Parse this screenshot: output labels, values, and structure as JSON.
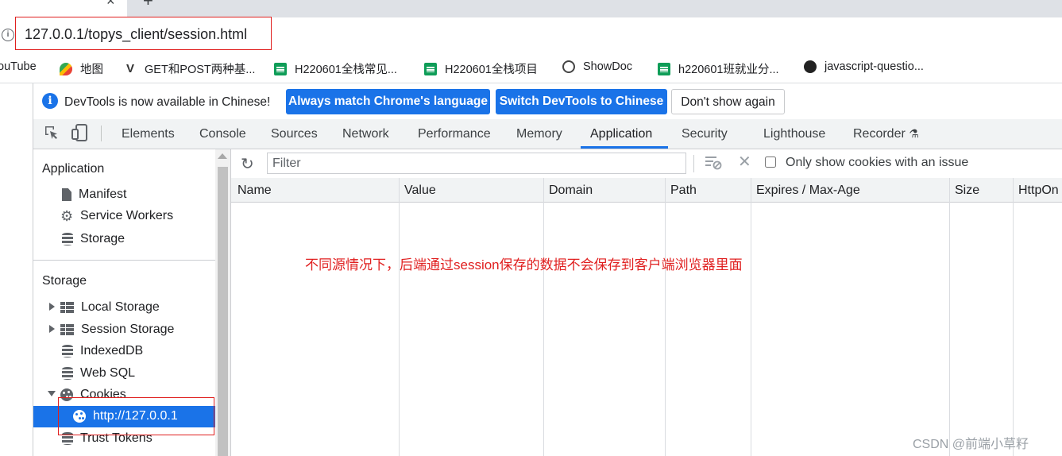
{
  "browser": {
    "url": "127.0.0.1/topys_client/session.html",
    "bookmarks": [
      {
        "label": "ouTube",
        "icon": "youtube-icon"
      },
      {
        "label": "地图",
        "icon": "maps-icon"
      },
      {
        "label": "GET和POST两种基...",
        "icon": "v-logo-icon"
      },
      {
        "label": "H220601全栈常见...",
        "icon": "sheets-icon"
      },
      {
        "label": "H220601全栈项目",
        "icon": "sheets-icon"
      },
      {
        "label": "ShowDoc",
        "icon": "globe-icon"
      },
      {
        "label": "h220601班就业分...",
        "icon": "sheets-icon"
      },
      {
        "label": "javascript-questio...",
        "icon": "github-icon"
      }
    ]
  },
  "infobar": {
    "message": "DevTools is now available in Chinese!",
    "btn_match": "Always match Chrome's language",
    "btn_switch": "Switch DevTools to Chinese",
    "btn_dont": "Don't show again"
  },
  "devtools": {
    "tabs": [
      "Elements",
      "Console",
      "Sources",
      "Network",
      "Performance",
      "Memory",
      "Application",
      "Security",
      "Lighthouse",
      "Recorder"
    ],
    "active_tab": "Application"
  },
  "sidebar": {
    "application_heading": "Application",
    "application_items": [
      "Manifest",
      "Service Workers",
      "Storage"
    ],
    "storage_heading": "Storage",
    "storage_items": [
      "Local Storage",
      "Session Storage",
      "IndexedDB",
      "Web SQL",
      "Cookies",
      "http://127.0.0.1",
      "Trust Tokens"
    ]
  },
  "cookies_panel": {
    "filter_placeholder": "Filter",
    "only_issue_label": "Only show cookies with an issue",
    "columns": [
      "Name",
      "Value",
      "Domain",
      "Path",
      "Expires / Max-Age",
      "Size",
      "HttpOn"
    ]
  },
  "annotation": "不同源情况下，后端通过session保存的数据不会保存到客户端浏览器里面",
  "watermark": "CSDN @前端小草籽",
  "colors": {
    "accent": "#1a73e8",
    "highlight_box": "#e0201f",
    "annotation": "#e02020"
  }
}
